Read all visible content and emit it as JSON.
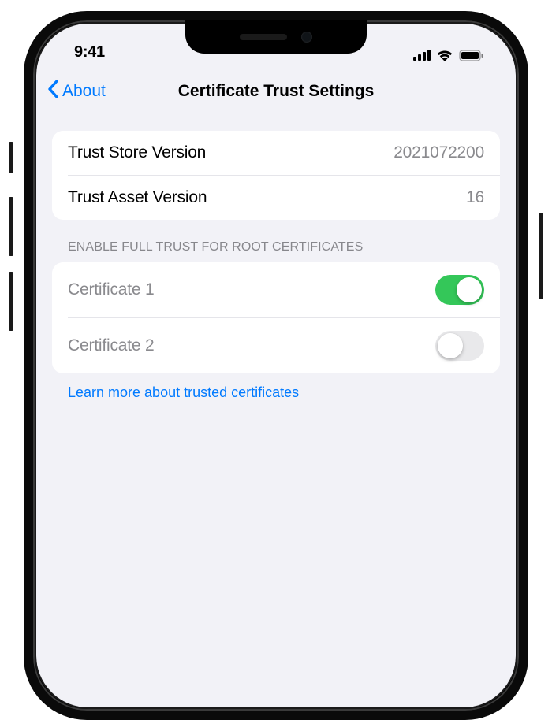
{
  "status": {
    "time": "9:41"
  },
  "nav": {
    "back_label": "About",
    "title": "Certificate Trust Settings"
  },
  "versions": {
    "store_label": "Trust Store Version",
    "store_value": "2021072200",
    "asset_label": "Trust Asset Version",
    "asset_value": "16"
  },
  "trust_section": {
    "header": "ENABLE FULL TRUST FOR ROOT CERTIFICATES",
    "items": [
      {
        "label": "Certificate 1",
        "enabled": true
      },
      {
        "label": "Certificate 2",
        "enabled": false
      }
    ]
  },
  "footer": {
    "link_text": "Learn more about trusted certificates"
  }
}
